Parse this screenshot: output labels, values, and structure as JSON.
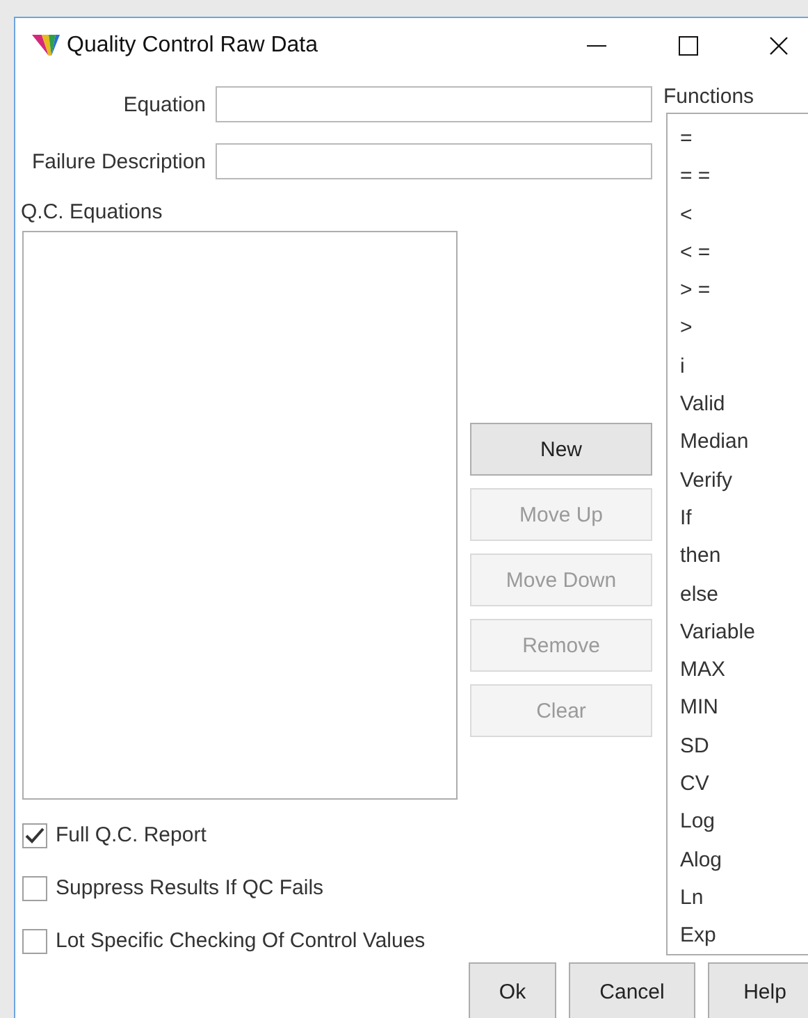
{
  "window": {
    "title": "Quality Control Raw Data"
  },
  "fields": [
    {
      "label": "Equation"
    },
    {
      "label": "Failure Description"
    }
  ],
  "equations": {
    "label": "Q.C. Equations"
  },
  "actions": [
    {
      "label": "New",
      "disabled": false
    },
    {
      "label": "Move Up",
      "disabled": true
    },
    {
      "label": "Move Down",
      "disabled": true
    },
    {
      "label": "Remove",
      "disabled": true
    },
    {
      "label": "Clear",
      "disabled": true
    }
  ],
  "options": [
    {
      "label": "Full Q.C. Report",
      "checked": true
    },
    {
      "label": "Suppress Results If QC Fails",
      "checked": false
    },
    {
      "label": "Lot Specific Checking Of Control Values",
      "checked": false
    }
  ],
  "functions": {
    "label": "Functions",
    "items": [
      "=",
      "= =",
      "<",
      "< =",
      "> =",
      ">",
      "i",
      "Valid",
      "Median",
      "Verify",
      "If",
      "then",
      "else",
      "Variable",
      "MAX",
      "MIN",
      "SD",
      "CV",
      "Log",
      "Alog",
      "Ln",
      "Exp"
    ]
  },
  "buttons": [
    "Ok",
    "Cancel",
    "Help"
  ]
}
